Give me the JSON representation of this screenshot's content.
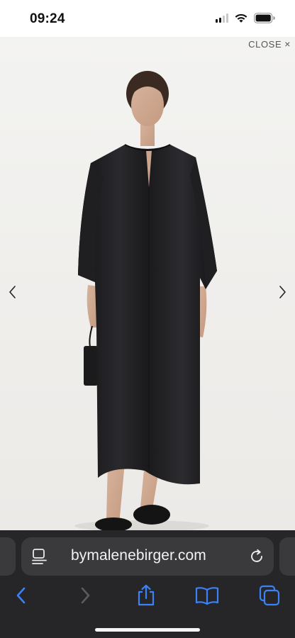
{
  "status_bar": {
    "time": "09:24",
    "signal_icon": "cellular-signal-icon",
    "wifi_icon": "wifi-icon",
    "battery_icon": "battery-icon"
  },
  "viewer": {
    "close_label": "CLOSE",
    "close_icon": "close-icon",
    "prev_icon": "chevron-left-icon",
    "next_icon": "chevron-right-icon",
    "image_subject": "product-photo"
  },
  "browser": {
    "url": "bymalenebirger.com",
    "reader_icon": "reader-mode-icon",
    "reload_icon": "reload-icon",
    "toolbar": {
      "back_icon": "back-arrow-icon",
      "forward_icon": "forward-arrow-icon",
      "share_icon": "share-icon",
      "bookmarks_icon": "bookmarks-icon",
      "tabs_icon": "tabs-icon"
    },
    "colors": {
      "chrome_bg": "#262628",
      "field_bg": "#3a3a3d",
      "accent": "#3b82f6"
    }
  }
}
